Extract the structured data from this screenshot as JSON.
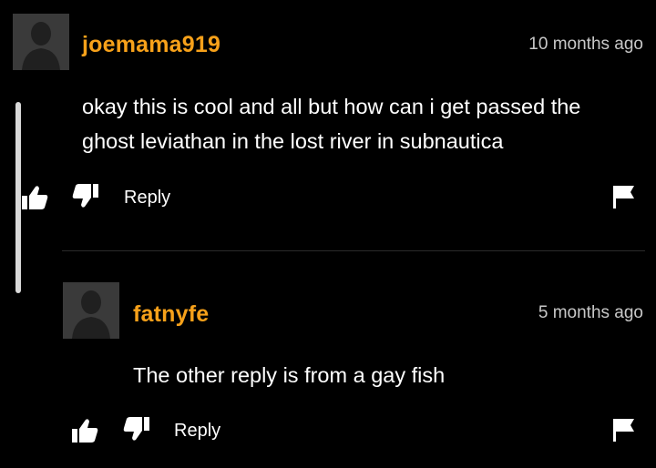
{
  "comments": [
    {
      "username": "joemama919",
      "time": "10 months ago",
      "text": "okay this is cool and all but how can i get passed the ghost leviathan in the lost river in subnautica",
      "reply_label": "Reply"
    },
    {
      "username": "fatnyfe",
      "time": "5 months ago",
      "text": "The other reply is from a gay fish",
      "reply_label": "Reply"
    }
  ],
  "colors": {
    "background": "#000000",
    "username": "#f7a11a",
    "timestamp": "#c8c8c8",
    "avatar": "#3a3a3a"
  }
}
